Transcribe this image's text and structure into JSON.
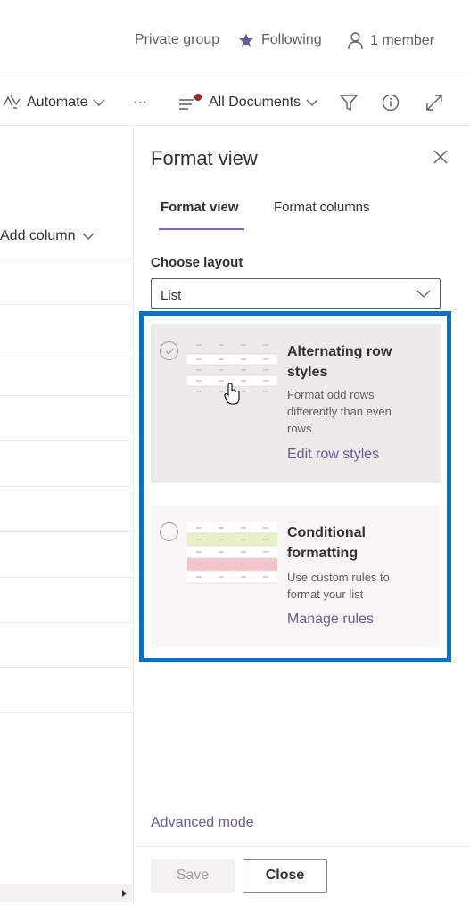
{
  "header": {
    "privacy": "Private group",
    "following": "Following",
    "members": "1 member"
  },
  "command_bar": {
    "automate": "Automate",
    "more": "···",
    "view_name": "All Documents"
  },
  "list": {
    "add_column": "Add column"
  },
  "panel": {
    "title": "Format view",
    "tabs": [
      {
        "label": "Format view",
        "active": true
      },
      {
        "label": "Format columns",
        "active": false
      }
    ],
    "choose_layout_label": "Choose layout",
    "layout_value": "List",
    "cards": [
      {
        "title": "Alternating row styles",
        "description": "Format odd rows differently than even rows",
        "link": "Edit row styles",
        "selected": false
      },
      {
        "title": "Conditional formatting",
        "description": "Use custom rules to format your list",
        "link": "Manage rules",
        "selected": false
      }
    ],
    "advanced_mode": "Advanced mode",
    "save_label": "Save",
    "close_label": "Close"
  },
  "colors": {
    "accent": "#8764b8",
    "highlight_border": "#0d70c7",
    "link": "#6b5b95",
    "green_row": "#e8f0c8",
    "red_row": "#f3c5cb"
  },
  "icons": [
    "star-icon",
    "person-icon",
    "automate-icon",
    "chevron-down-icon",
    "view-options-icon",
    "filter-icon",
    "info-icon",
    "expand-icon",
    "close-icon",
    "check-circle-icon",
    "hand-cursor-icon"
  ]
}
